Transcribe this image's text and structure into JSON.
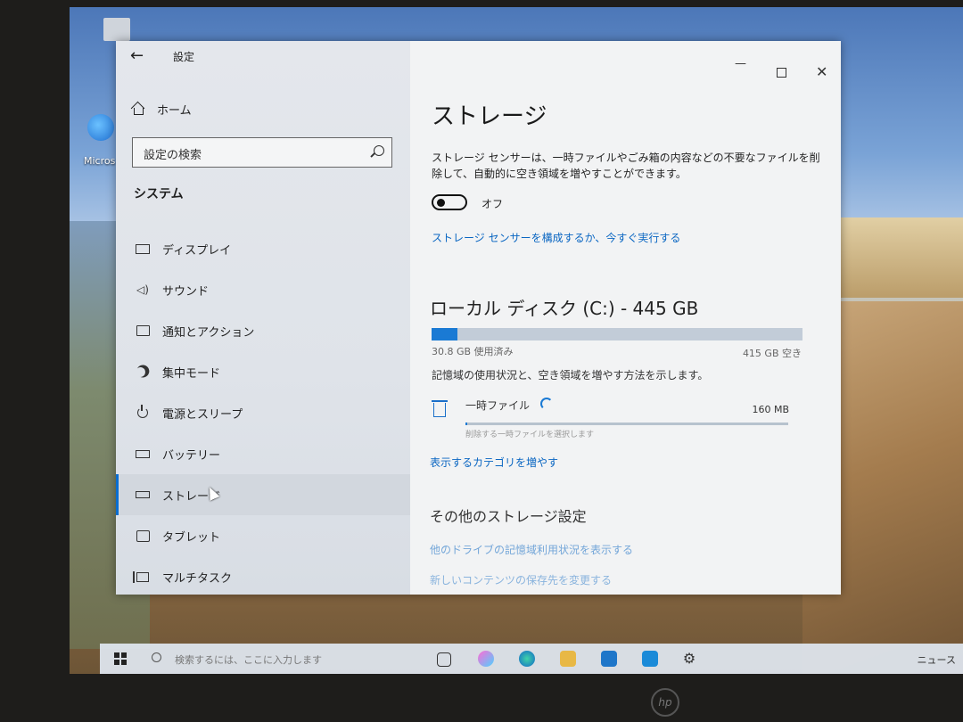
{
  "window": {
    "title": "設定",
    "back": "←",
    "min": "—",
    "close": "✕"
  },
  "desktop": {
    "icon_label": "Micros"
  },
  "sidebar": {
    "home": "ホーム",
    "search_placeholder": "設定の検索",
    "section": "システム",
    "items": [
      {
        "label": "ディスプレイ"
      },
      {
        "label": "サウンド"
      },
      {
        "label": "通知とアクション"
      },
      {
        "label": "集中モード"
      },
      {
        "label": "電源とスリープ"
      },
      {
        "label": "バッテリー"
      },
      {
        "label": "ストレージ"
      },
      {
        "label": "タブレット"
      },
      {
        "label": "マルチタスク"
      }
    ]
  },
  "main": {
    "title": "ストレージ",
    "description": "ストレージ センサーは、一時ファイルやごみ箱の内容などの不要なファイルを削除して、自動的に空き領域を増やすことができます。",
    "toggle_label": "オフ",
    "toggle_on": false,
    "configure_link": "ストレージ センサーを構成するか、今すぐ実行する",
    "disk_title": "ローカル ディスク (C:) - 445 GB",
    "used_label": "30.8 GB 使用済み",
    "free_label": "415 GB 空き",
    "used_fraction": 0.069,
    "usage_desc": "記憶域の使用状況と、空き領域を増やす方法を示します。",
    "temp_label": "一時ファイル",
    "temp_size": "160 MB",
    "temp_hint": "削除する一時ファイルを選択します",
    "temp_fraction": 0.005,
    "more_categories_link": "表示するカテゴリを増やす",
    "other_head": "その他のストレージ設定",
    "other_link1": "他のドライブの記憶域利用状況を表示する",
    "other_link2": "新しいコンテンツの保存先を変更する"
  },
  "taskbar": {
    "search_placeholder": "検索するには、ここに入力します",
    "news": "ニュース"
  },
  "colors": {
    "accent": "#1a7ad4",
    "link": "#0a66c2"
  }
}
